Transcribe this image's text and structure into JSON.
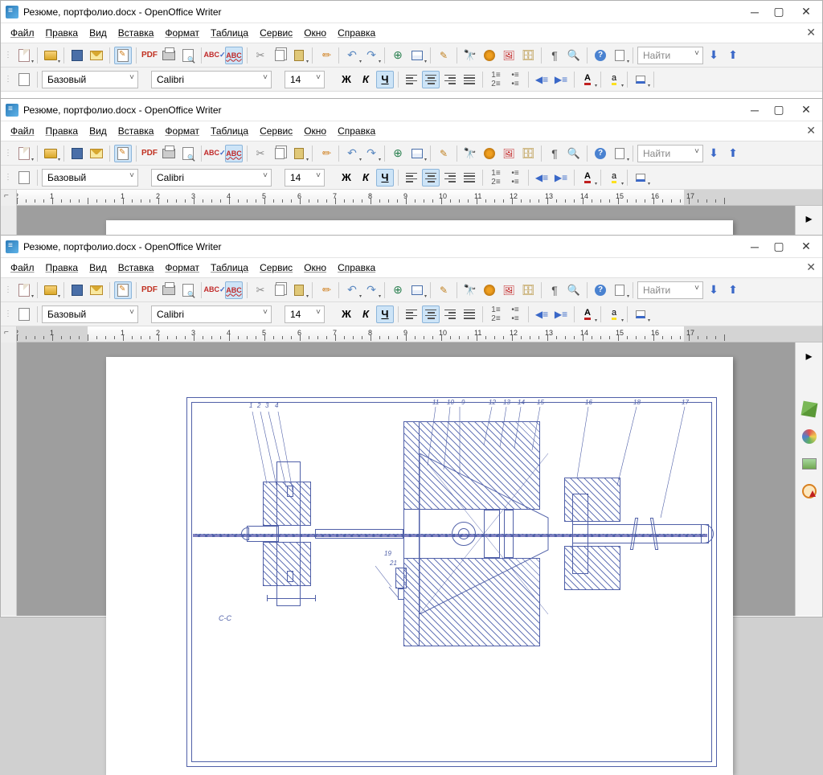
{
  "title": "Резюме, портфолио.docx - OpenOffice Writer",
  "menu": {
    "file": "Файл",
    "edit": "Правка",
    "view": "Вид",
    "insert": "Вставка",
    "format": "Формат",
    "table": "Таблица",
    "tools": "Сервис",
    "window": "Окно",
    "help": "Справка"
  },
  "toolbar": {
    "find_placeholder": "Найти"
  },
  "format": {
    "style": "Базовый",
    "font": "Calibri",
    "size": "14",
    "bold": "Ж",
    "italic": "К",
    "underline": "Ч",
    "fontcolor_letter": "A",
    "hilite_letter": "a"
  },
  "ruler": {
    "nums": [
      "2",
      "1",
      "1",
      "2",
      "3",
      "4",
      "5",
      "6",
      "7",
      "8",
      "9",
      "10",
      "11",
      "12",
      "13",
      "14",
      "15",
      "16",
      "17"
    ]
  },
  "drawing": {
    "section_label": "С-С",
    "balloons": [
      "1",
      "2",
      "3",
      "4",
      "10",
      "9",
      "12",
      "13",
      "14",
      "15",
      "16",
      "18",
      "17",
      "11",
      "19",
      "21"
    ]
  }
}
